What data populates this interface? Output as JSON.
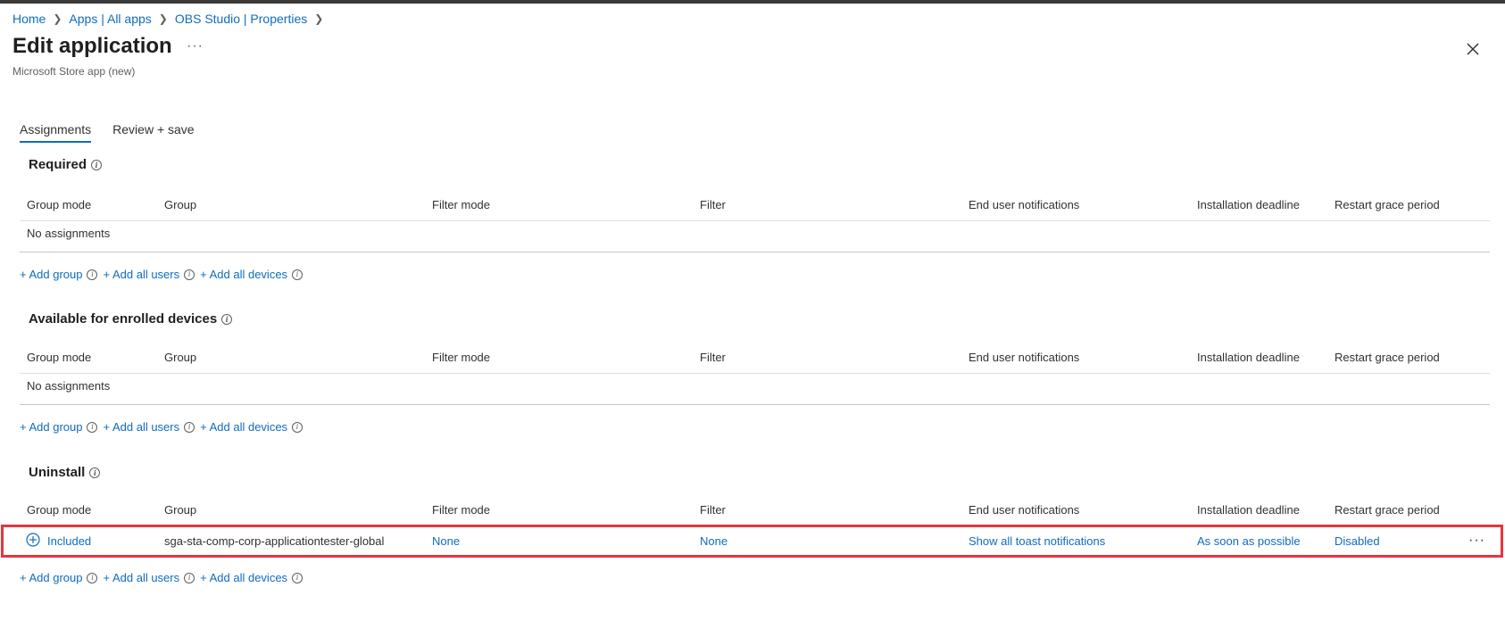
{
  "breadcrumb": [
    {
      "label": "Home"
    },
    {
      "label": "Apps | All apps"
    },
    {
      "label": "OBS Studio | Properties"
    }
  ],
  "header": {
    "title": "Edit application",
    "more": "···",
    "subtitle": "Microsoft Store app (new)"
  },
  "tabs": [
    {
      "label": "Assignments",
      "active": true
    },
    {
      "label": "Review + save",
      "active": false
    }
  ],
  "columns": [
    "Group mode",
    "Group",
    "Filter mode",
    "Filter",
    "End user notifications",
    "Installation deadline",
    "Restart grace period"
  ],
  "sections": {
    "required": {
      "title": "Required",
      "empty_text": "No assignments"
    },
    "available": {
      "title": "Available for enrolled devices",
      "empty_text": "No assignments"
    },
    "uninstall": {
      "title": "Uninstall",
      "row": {
        "group_mode": "Included",
        "group": "sga-sta-comp-corp-applicationtester-global",
        "filter_mode": "None",
        "filter": "None",
        "notifications": "Show all toast notifications",
        "deadline": "As soon as possible",
        "restart": "Disabled",
        "more": "···"
      }
    }
  },
  "actions": {
    "add_group": "+ Add group",
    "add_all_users": "+ Add all users",
    "add_all_devices": "+ Add all devices"
  },
  "colors": {
    "link": "#0f6cbd",
    "highlight": "#e6353e"
  }
}
